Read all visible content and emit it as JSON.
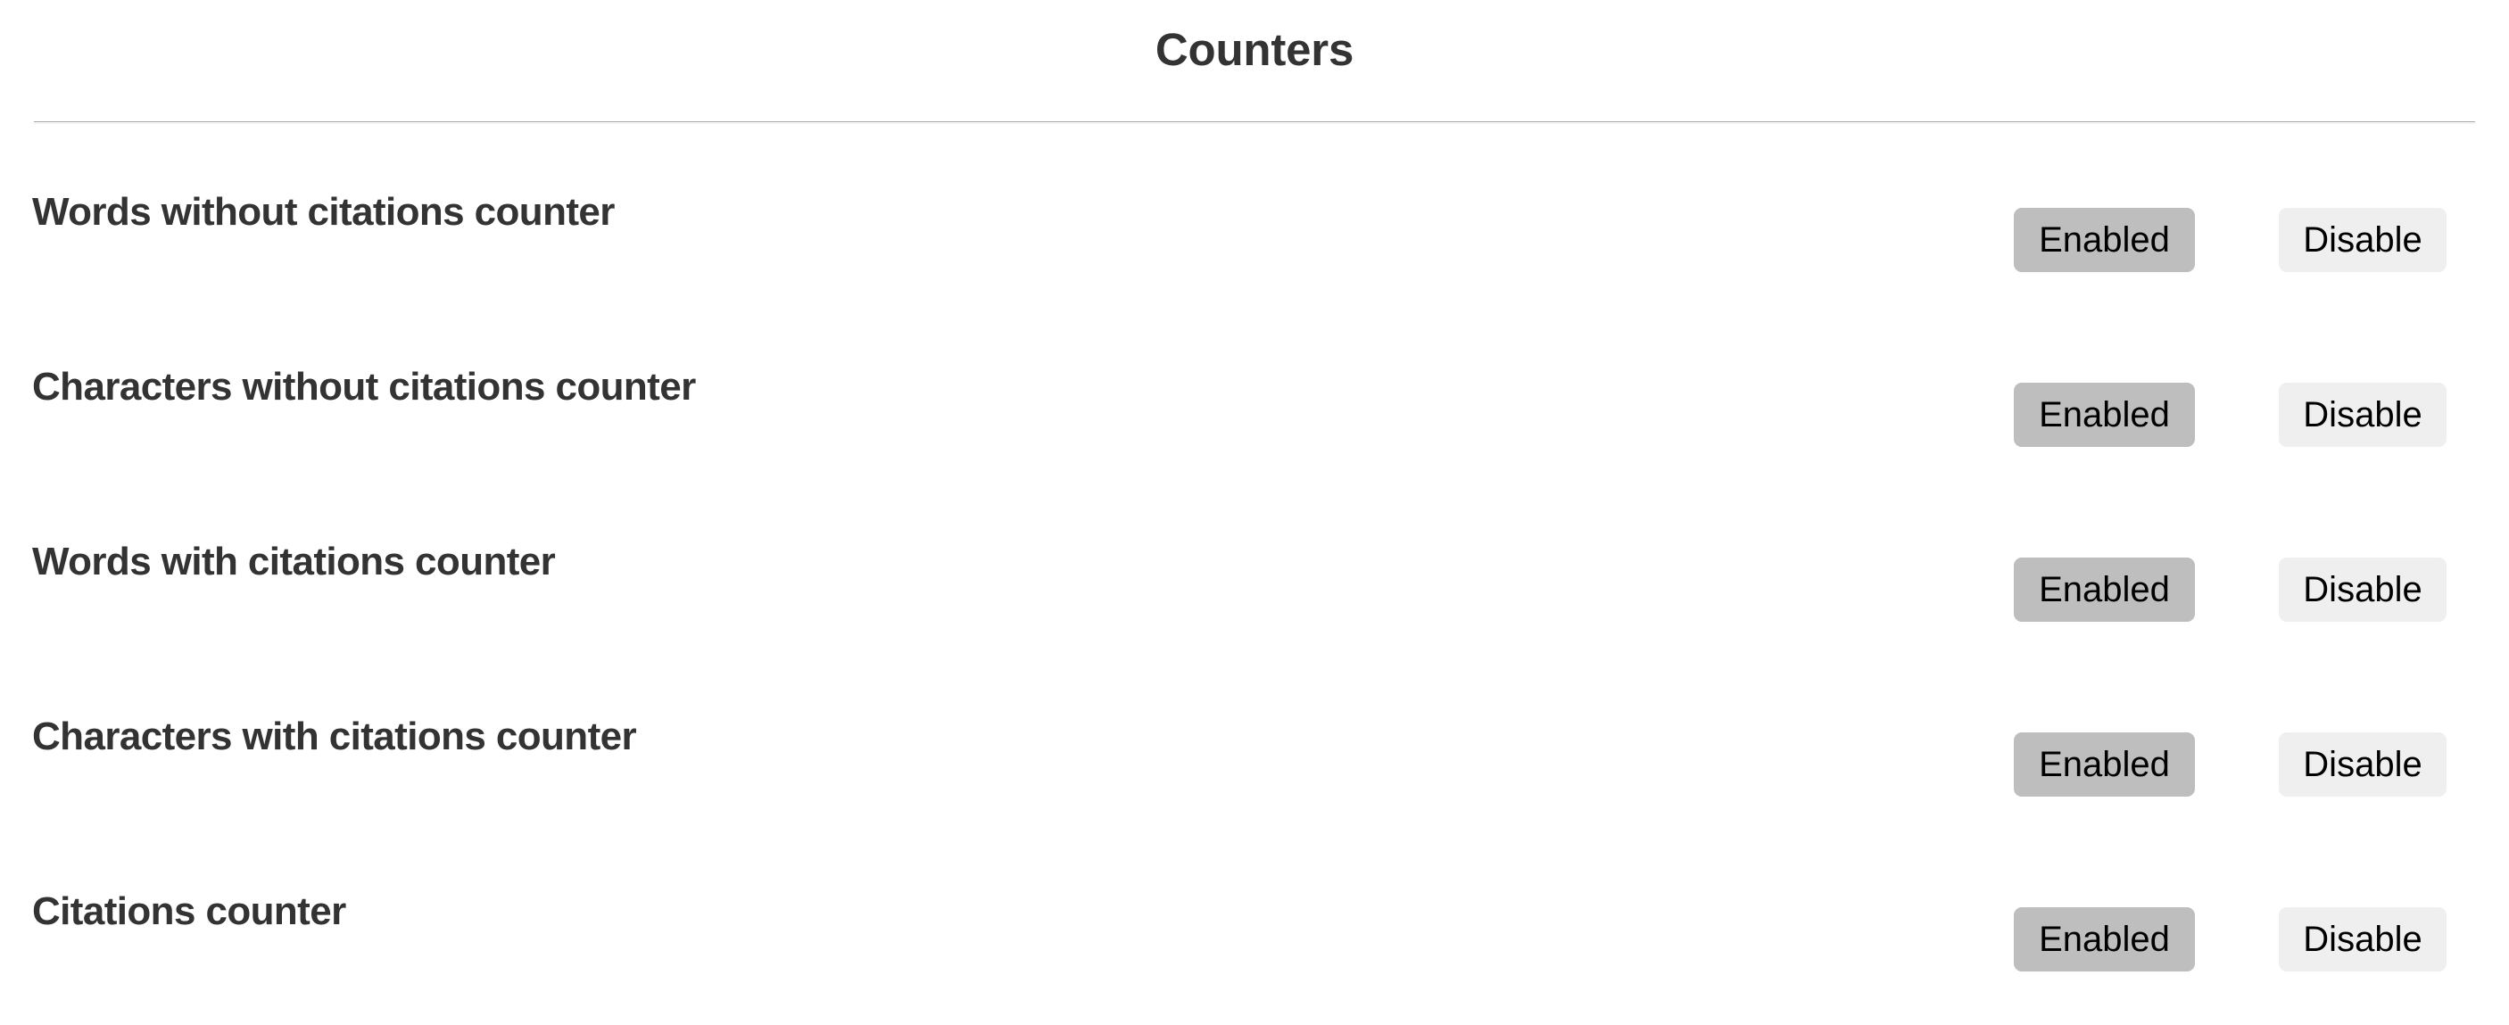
{
  "header": {
    "title": "Counters"
  },
  "colors": {
    "text_primary": "#333333",
    "button_state_bg": "#bebebe",
    "button_action_bg": "#efefef",
    "divider": "#a2a2a2",
    "background": "#ffffff"
  },
  "rows": [
    {
      "label": "Words without citations counter",
      "state_label": "Enabled",
      "action_label": "Disable"
    },
    {
      "label": "Characters without citations counter",
      "state_label": "Enabled",
      "action_label": "Disable"
    },
    {
      "label": "Words with citations counter",
      "state_label": "Enabled",
      "action_label": "Disable"
    },
    {
      "label": "Characters with citations counter",
      "state_label": "Enabled",
      "action_label": "Disable"
    },
    {
      "label": "Citations counter",
      "state_label": "Enabled",
      "action_label": "Disable"
    }
  ]
}
